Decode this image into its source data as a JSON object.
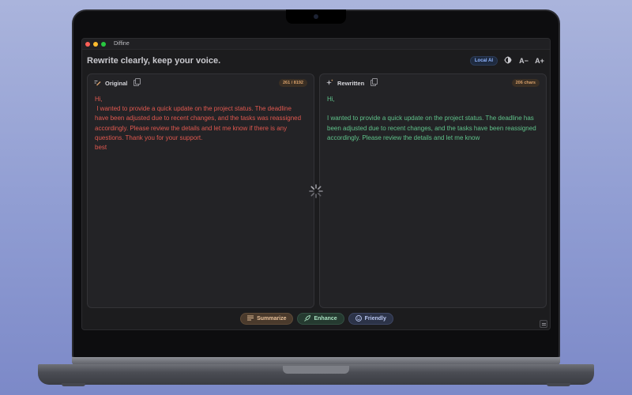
{
  "window": {
    "title": "Diffine"
  },
  "header": {
    "tagline": "Rewrite clearly, keep your voice.",
    "local_ai_badge": "Local AI",
    "font_decrease": "A−",
    "font_increase": "A+"
  },
  "original": {
    "title": "Original",
    "count": "261 / 8192",
    "text": "Hi,\n I wanted to provide a quick update on the project status. The deadline have been adjusted due to recent changes, and the tasks was reassigned accordingly. Please review the details and let me know if there is any questions. Thank you for your support.\nbest"
  },
  "rewritten": {
    "title": "Rewritten",
    "count": "206 chars",
    "text": "Hi,\n\nI wanted to provide a quick update on the project status. The deadline has been adjusted due to recent changes, and the tasks have been reassigned accordingly. Please review the details and let me know"
  },
  "actions": {
    "summarize": "Summarize",
    "enhance": "Enhance",
    "friendly": "Friendly"
  },
  "colors": {
    "original_text": "#e0584f",
    "rewritten_text": "#5fc28a",
    "count_badge": "#d8a06a"
  }
}
